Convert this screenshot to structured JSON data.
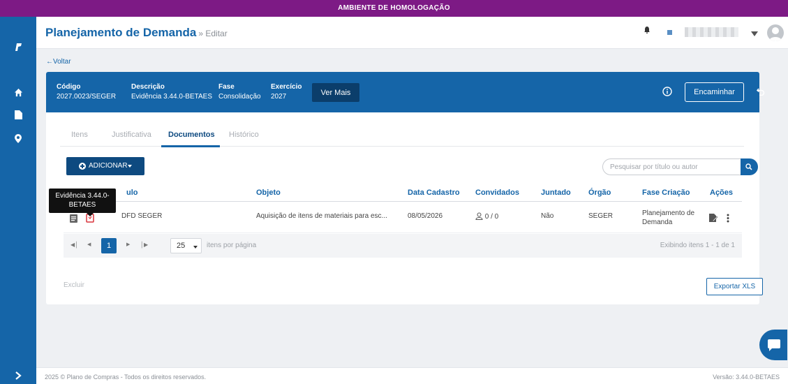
{
  "environment_banner": "AMBIENTE DE HOMOLOGAÇÃO",
  "header": {
    "title": "Planejamento de Demanda",
    "subtitle": "» Editar"
  },
  "sidebar": {
    "icons": [
      "logo-icon",
      "home-icon",
      "document-icon",
      "pin-icon",
      "expand-icon"
    ]
  },
  "back_label": "Voltar",
  "info": {
    "codigo_label": "Código",
    "codigo_value": "2027.0023/SEGER",
    "descricao_label": "Descrição",
    "descricao_value": "Evidência 3.44.0-BETAES",
    "fase_label": "Fase",
    "fase_value": "Consolidação",
    "exercicio_label": "Exercício",
    "exercicio_value": "2027",
    "ver_mais_label": "Ver Mais",
    "encaminhar_label": "Encaminhar"
  },
  "tabs": [
    {
      "label": "Itens",
      "active": false
    },
    {
      "label": "Justificativa",
      "active": false
    },
    {
      "label": "Documentos",
      "active": true
    },
    {
      "label": "Histórico",
      "active": false
    }
  ],
  "toolbar": {
    "adicionar_label": "ADICIONAR",
    "search_placeholder": "Pesquisar por título ou autor"
  },
  "table": {
    "columns": [
      "Título",
      "Objeto",
      "Data Cadastro",
      "Convidados",
      "Juntado",
      "Órgão",
      "Fase Criação",
      "Ações"
    ],
    "visible_title_header": "ulo",
    "rows": [
      {
        "titulo": "DFD SEGER",
        "objeto": "Aquisição de itens de materiais para esc...",
        "data_cadastro": "08/05/2026",
        "convidados": "0 / 0",
        "juntado": "Não",
        "orgao": "SEGER",
        "fase_criacao_line1": "Planejamento de",
        "fase_criacao_line2": "Demanda"
      }
    ]
  },
  "tooltip": {
    "line1": "Evidência 3.44.0-",
    "line2": "BETAES"
  },
  "pager": {
    "current_page": "1",
    "page_size": "25",
    "page_size_label": "itens por página",
    "summary": "Exibindo itens 1 - 1 de 1"
  },
  "actions": {
    "excluir_label": "Excluir",
    "exportar_label": "Exportar XLS"
  },
  "footer": {
    "copyright": "2025 © Plano de Compras - Todos os direitos reservados.",
    "version": "Versão: 3.44.0-BETAES"
  },
  "colors": {
    "primary": "#1565a8",
    "dark": "#0e4a80",
    "banner": "#7d1a85"
  }
}
